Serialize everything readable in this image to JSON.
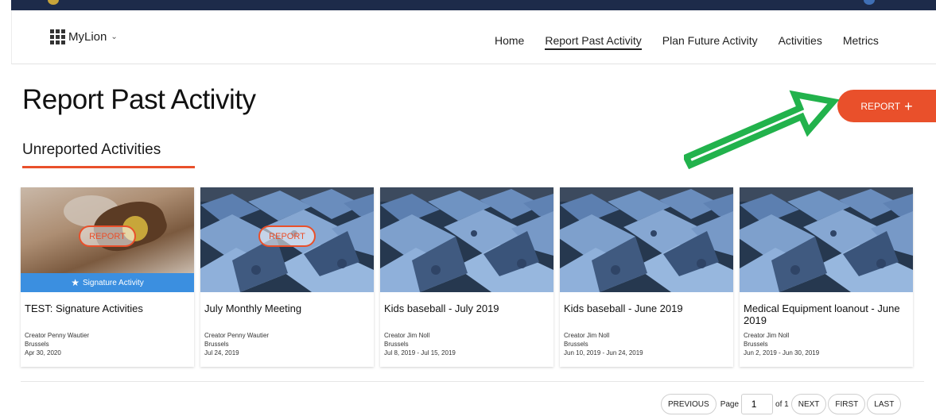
{
  "nav": {
    "brand": "MyLion",
    "links": [
      {
        "label": "Home"
      },
      {
        "label": "Report Past Activity",
        "active": true
      },
      {
        "label": "Plan Future Activity"
      },
      {
        "label": "Activities"
      },
      {
        "label": "Metrics"
      }
    ]
  },
  "page": {
    "title": "Report Past Activity",
    "report_button": "REPORT",
    "report_button_icon": "plus-icon"
  },
  "section": {
    "title": "Unreported Activities"
  },
  "cards": [
    {
      "title": "TEST: Signature Activities",
      "creator": "Creator Penny Wautier",
      "location": "Brussels",
      "date": "Apr 30, 2020",
      "image": "hands-photo",
      "badge": "REPORT",
      "signature_label": "Signature Activity"
    },
    {
      "title": "July Monthly Meeting",
      "creator": "Creator Penny Wautier",
      "location": "Brussels",
      "date": "Jul 24, 2019",
      "image": "tents-photo",
      "badge": "REPORT"
    },
    {
      "title": "Kids baseball - July 2019",
      "creator": "Creator Jim Noll",
      "location": "Brussels",
      "date": "Jul 8, 2019 - Jul 15, 2019",
      "image": "tents-photo"
    },
    {
      "title": "Kids baseball - June 2019",
      "creator": "Creator Jim Noll",
      "location": "Brussels",
      "date": "Jun 10, 2019 - Jun 24, 2019",
      "image": "tents-photo"
    },
    {
      "title": "Medical Equipment loanout - June 2019",
      "creator": "Creator Jim Noll",
      "location": "Brussels",
      "date": "Jun 2, 2019 - Jun 30, 2019",
      "image": "tents-photo"
    }
  ],
  "pagination": {
    "previous": "PREVIOUS",
    "page_label": "Page",
    "page_value": "1",
    "of_label": "of 1",
    "next": "NEXT",
    "first": "FIRST",
    "last": "LAST"
  },
  "colors": {
    "accent": "#e9502b",
    "signature": "#3b8fe0",
    "annotation_arrow": "#22b24c",
    "top_strip": "#1d2b4a"
  }
}
